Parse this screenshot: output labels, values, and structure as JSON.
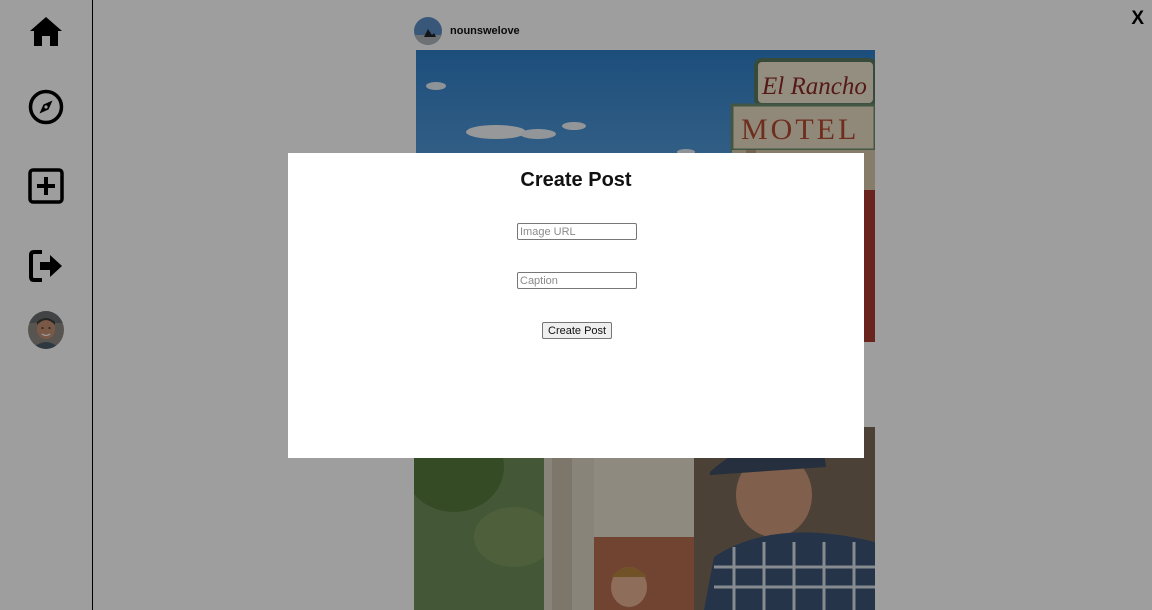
{
  "sidebar": {
    "items": [
      {
        "name": "home-icon"
      },
      {
        "name": "compass-icon"
      },
      {
        "name": "add-square-icon"
      },
      {
        "name": "sign-out-icon"
      },
      {
        "name": "profile-avatar"
      }
    ]
  },
  "feed": {
    "posts": [
      {
        "username": "nounswelove",
        "image": "El Rancho Motel sign against blue sky"
      },
      {
        "username": "",
        "image": "Man in plaid shirt and cap with child on porch"
      }
    ]
  },
  "modal": {
    "title": "Create Post",
    "image_url_placeholder": "Image URL",
    "image_url_value": "",
    "caption_placeholder": "Caption",
    "caption_value": "",
    "submit_label": "Create Post",
    "close_label": "X"
  },
  "colors": {
    "overlay": "rgba(0,0,0,0.38)",
    "modal_bg": "#ffffff",
    "icon": "#000000"
  }
}
